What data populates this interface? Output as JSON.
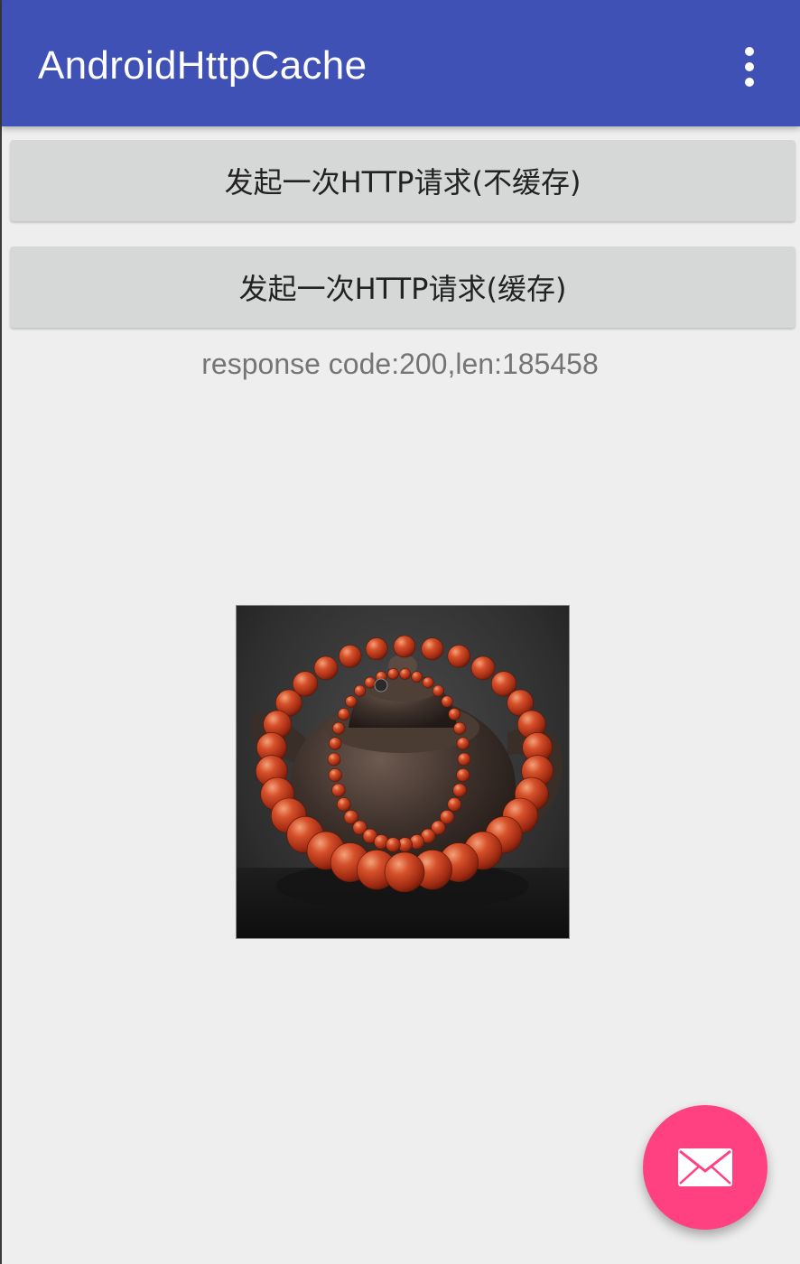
{
  "toolbar": {
    "title": "AndroidHttpCache",
    "menu_icon": "more-vert-icon"
  },
  "buttons": {
    "no_cache_label": "发起一次HTTP请求(不缓存)",
    "cache_label": "发起一次HTTP请求(缓存)"
  },
  "status": {
    "text": "response code:200,len:185458"
  },
  "image": {
    "subject": "teapot-with-red-bead-necklace"
  },
  "fab": {
    "icon": "mail-icon"
  },
  "colors": {
    "primary": "#3f51b5",
    "accent": "#ff4081",
    "background": "#eeeeee",
    "button": "#d6d7d7"
  }
}
